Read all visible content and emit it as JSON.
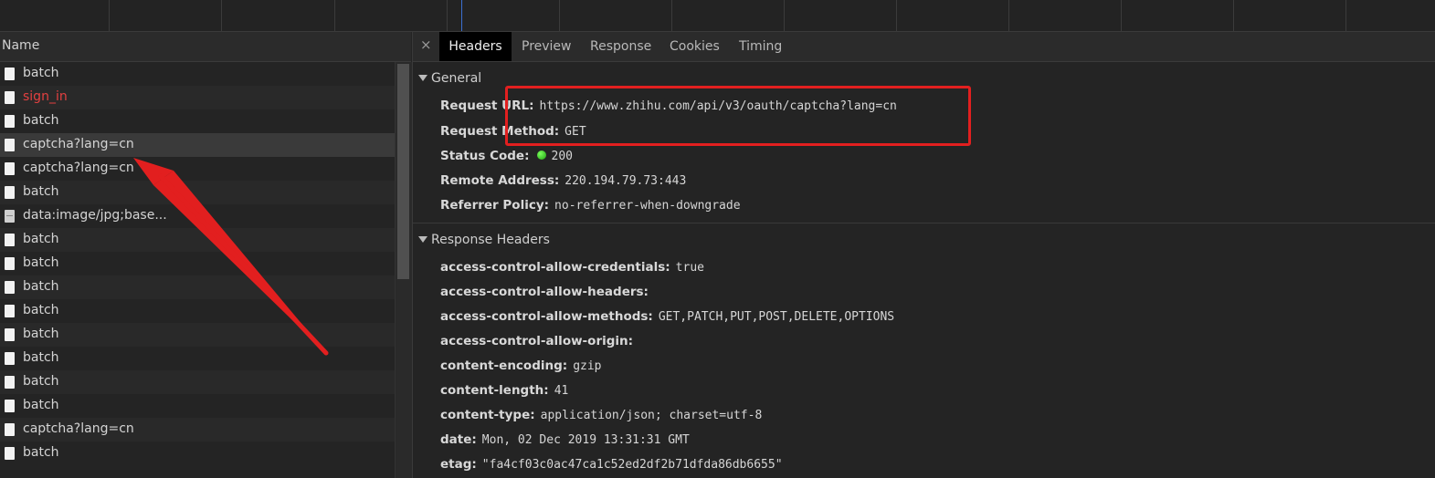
{
  "name_column": {
    "header": "Name"
  },
  "requests": [
    {
      "name": "batch",
      "status": "ok",
      "icon": "file-icon"
    },
    {
      "name": "sign_in",
      "status": "error",
      "icon": "file-icon"
    },
    {
      "name": "batch",
      "status": "ok",
      "icon": "file-icon"
    },
    {
      "name": "captcha?lang=cn",
      "status": "ok",
      "icon": "file-icon",
      "selected": true
    },
    {
      "name": "captcha?lang=cn",
      "status": "ok",
      "icon": "file-icon"
    },
    {
      "name": "batch",
      "status": "ok",
      "icon": "file-icon"
    },
    {
      "name": "data:image/jpg;base...",
      "status": "ok",
      "icon": "image-file-icon"
    },
    {
      "name": "batch",
      "status": "ok",
      "icon": "file-icon"
    },
    {
      "name": "batch",
      "status": "ok",
      "icon": "file-icon"
    },
    {
      "name": "batch",
      "status": "ok",
      "icon": "file-icon"
    },
    {
      "name": "batch",
      "status": "ok",
      "icon": "file-icon"
    },
    {
      "name": "batch",
      "status": "ok",
      "icon": "file-icon"
    },
    {
      "name": "batch",
      "status": "ok",
      "icon": "file-icon"
    },
    {
      "name": "batch",
      "status": "ok",
      "icon": "file-icon"
    },
    {
      "name": "batch",
      "status": "ok",
      "icon": "file-icon"
    },
    {
      "name": "captcha?lang=cn",
      "status": "ok",
      "icon": "file-icon"
    },
    {
      "name": "batch",
      "status": "ok",
      "icon": "file-icon"
    }
  ],
  "tabs": {
    "close": "×",
    "headers": "Headers",
    "preview": "Preview",
    "response": "Response",
    "cookies": "Cookies",
    "timing": "Timing",
    "active": "Headers"
  },
  "general": {
    "title": "General",
    "request_url_key": "Request URL:",
    "request_url": "https://www.zhihu.com/api/v3/oauth/captcha?lang=cn",
    "request_method_key": "Request Method:",
    "request_method": "GET",
    "status_code_key": "Status Code:",
    "status_code": "200",
    "remote_address_key": "Remote Address:",
    "remote_address": "220.194.79.73:443",
    "referrer_policy_key": "Referrer Policy:",
    "referrer_policy": "no-referrer-when-downgrade"
  },
  "response_headers": {
    "title": "Response Headers",
    "items": [
      {
        "key": "access-control-allow-credentials:",
        "value": "true"
      },
      {
        "key": "access-control-allow-headers:",
        "value": ""
      },
      {
        "key": "access-control-allow-methods:",
        "value": "GET,PATCH,PUT,POST,DELETE,OPTIONS"
      },
      {
        "key": "access-control-allow-origin:",
        "value": ""
      },
      {
        "key": "content-encoding:",
        "value": "gzip"
      },
      {
        "key": "content-length:",
        "value": "41"
      },
      {
        "key": "content-type:",
        "value": "application/json; charset=utf-8"
      },
      {
        "key": "date:",
        "value": "Mon, 02 Dec 2019 13:31:31 GMT"
      },
      {
        "key": "etag:",
        "value": "\"fa4cf03c0ac47ca1c52ed2df2b71dfda86db6655\""
      }
    ]
  },
  "colors": {
    "error_text": "#e34040",
    "annotation_red": "#e21f1f",
    "status_green": "#2bd11a",
    "active_tab_bg": "#000000"
  }
}
